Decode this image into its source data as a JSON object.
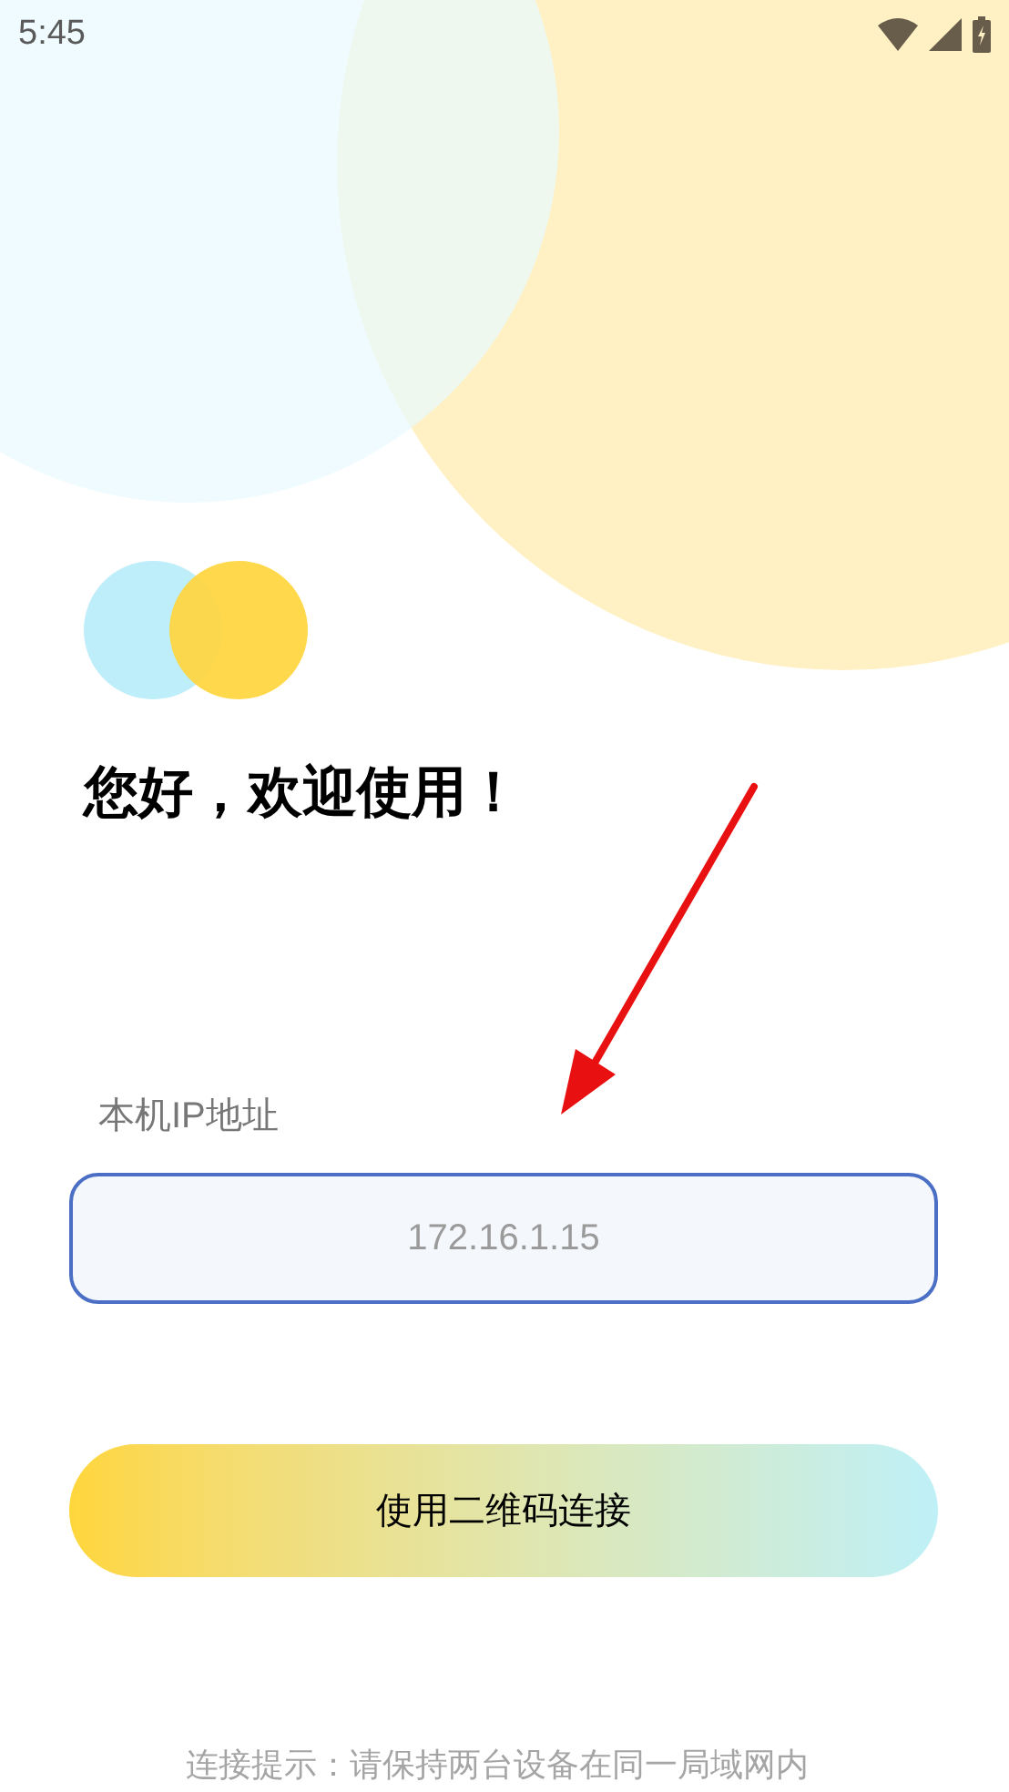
{
  "status_bar": {
    "time": "5:45"
  },
  "greeting": "您好，欢迎使用！",
  "ip_field": {
    "label": "本机IP地址",
    "value": "172.16.1.15"
  },
  "qr_button": {
    "label": "使用二维码连接"
  },
  "hint": "连接提示：请保持两台设备在同一局域网内"
}
